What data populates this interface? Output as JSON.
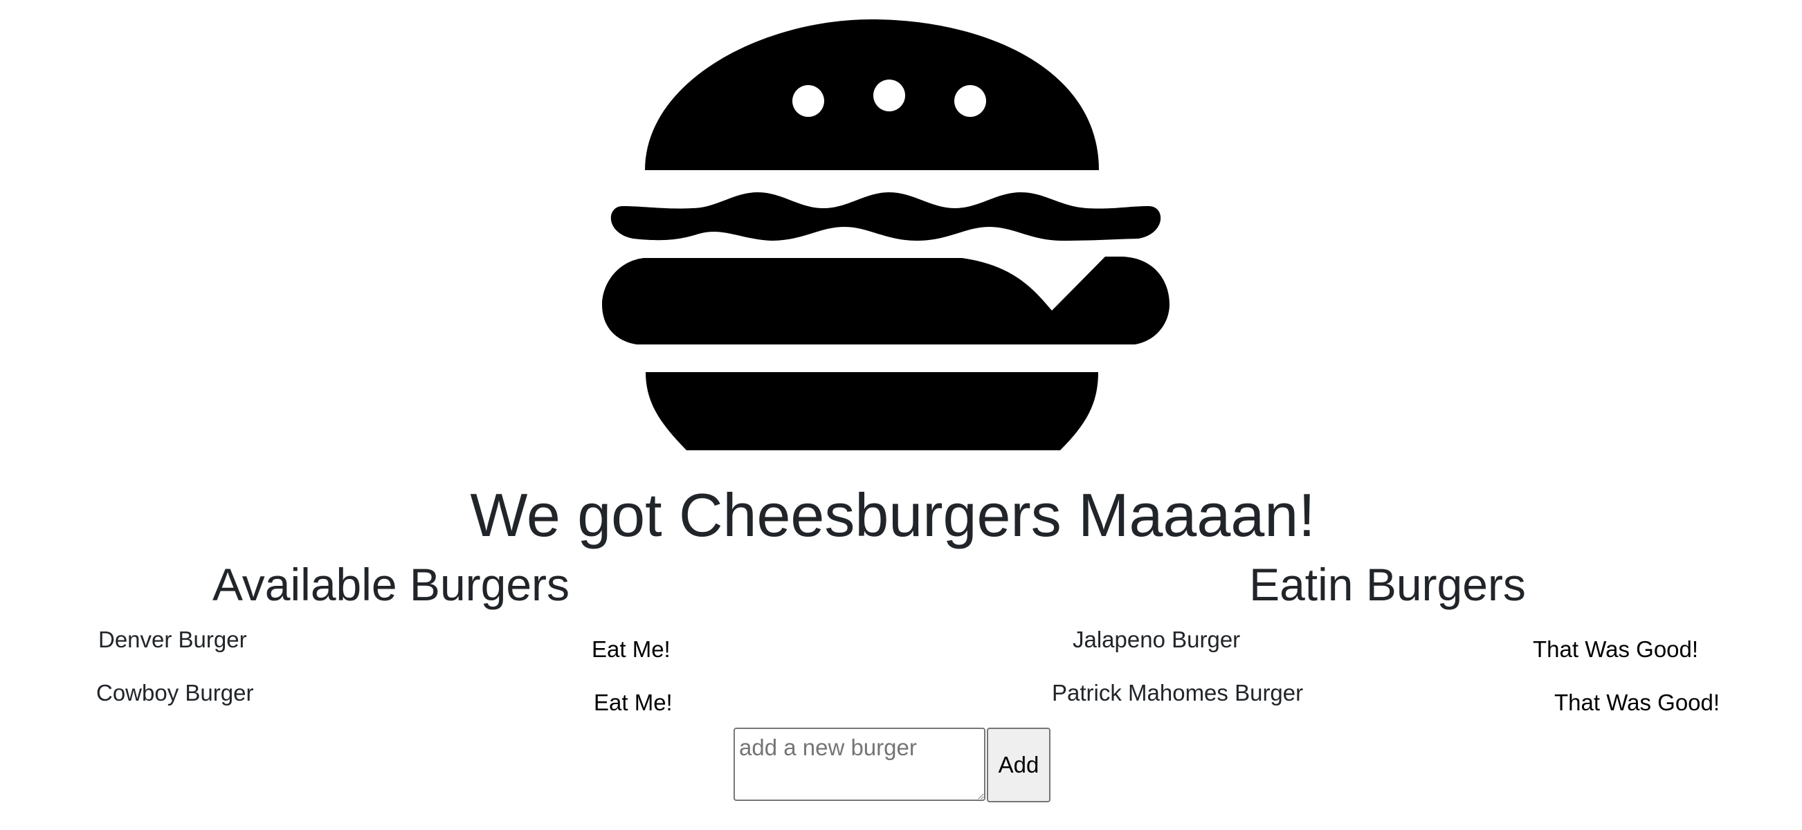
{
  "header": {
    "title": "We got Cheesburgers Maaaan!"
  },
  "available": {
    "heading": "Available Burgers",
    "items": [
      {
        "name": "Denver Burger",
        "action": "Eat Me!"
      },
      {
        "name": "Cowboy Burger",
        "action": "Eat Me!"
      }
    ]
  },
  "eaten": {
    "heading": "Eatin Burgers",
    "items": [
      {
        "name": "Jalapeno Burger",
        "action": "That Was Good!"
      },
      {
        "name": "Patrick Mahomes Burger",
        "action": "That Was Good!"
      }
    ]
  },
  "form": {
    "placeholder": "add a new burger",
    "value": "",
    "submit_label": "Add"
  },
  "icons": {
    "logo": "hamburger-icon"
  }
}
